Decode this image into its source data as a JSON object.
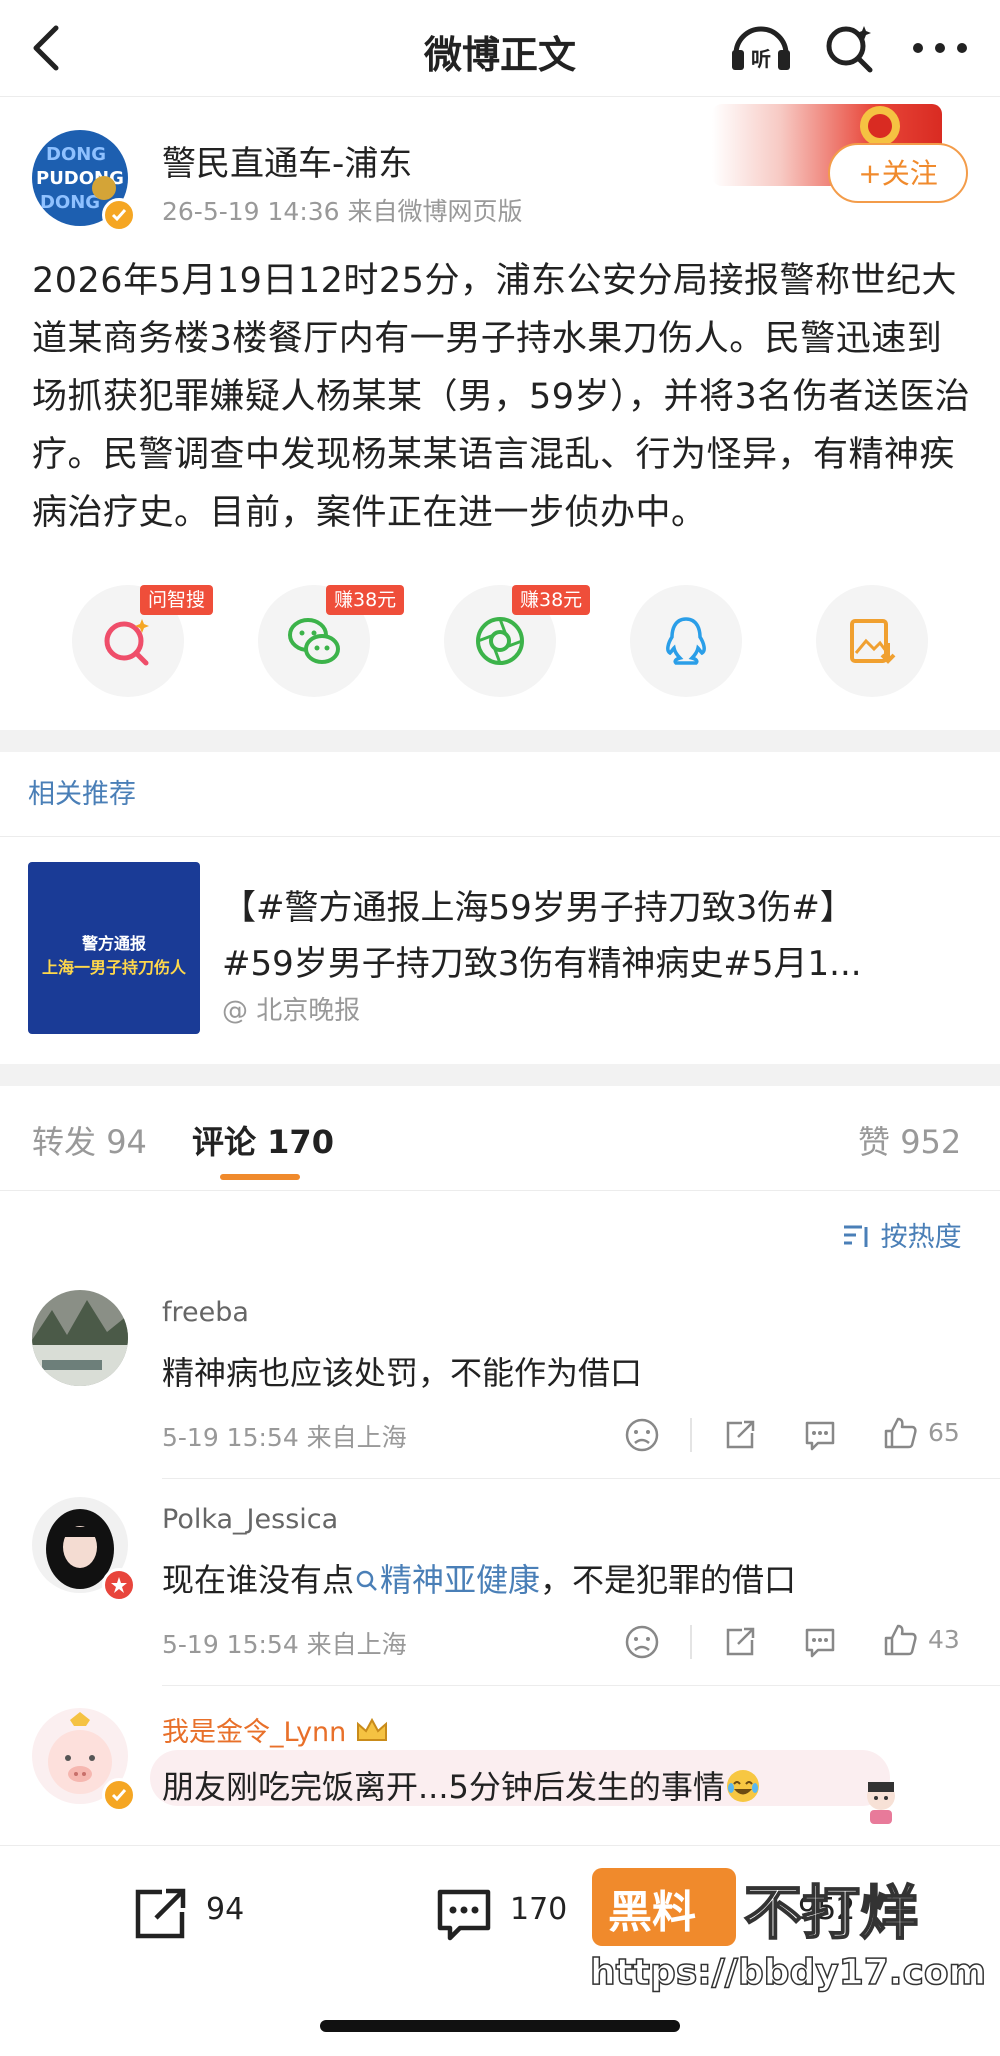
{
  "header": {
    "title": "微博正文",
    "listen_label": "听"
  },
  "post": {
    "username": "警民直通车-浦东",
    "meta": "26-5-19 14:36  来自微博网页版",
    "follow_label": "+关注",
    "avatar_text": [
      "DONG",
      "PUDONG",
      "DONG"
    ],
    "body": "2026年5月19日12时25分，浦东公安分局接报警称世纪大道某商务楼3楼餐厅内有一男子持水果刀伤人。民警迅速到场抓获犯罪嫌疑人杨某某（男，59岁），并将3名伤者送医治疗。民警调查中发现杨某某语言混乱、行为怪异，有精神疾病治疗史。目前，案件正在进一步侦办中。"
  },
  "share": {
    "badges": [
      "问智搜",
      "赚38元",
      "赚38元"
    ],
    "icons": [
      "ai-search-icon",
      "wechat-icon",
      "moments-icon",
      "qq-icon",
      "save-image-icon"
    ]
  },
  "related": {
    "label": "相关推荐",
    "thumb_line1": "警方通报",
    "thumb_line2": "上海一男子持刀伤人",
    "line1": "【#警方通报上海59岁男子持刀致3伤#】",
    "line2": "#59岁男子持刀致3伤有精神病史#5月1...",
    "source": "@ 北京晚报"
  },
  "tabs": {
    "repost_label": "转发",
    "repost_count": "94",
    "comment_label": "评论",
    "comment_count": "170",
    "like_label": "赞",
    "like_count": "952"
  },
  "sort_label": "按热度",
  "comments": [
    {
      "name": "freeba",
      "text": "精神病也应该处罚，不能作为借口",
      "meta": "5-19 15:54  来自上海",
      "likes": "65"
    },
    {
      "name": "Polka_Jessica",
      "text_before": "现在谁没有点",
      "topic": "精神亚健康",
      "text_after": "，不是犯罪的借口",
      "meta": "5-19 15:54  来自上海",
      "likes": "43"
    },
    {
      "name": "我是金令_Lynn",
      "text": "朋友刚吃完饭离开...5分钟后发生的事情"
    }
  ],
  "bottom": {
    "repost_count": "94",
    "comment_count": "170",
    "like_count_partial": "952"
  },
  "watermark": {
    "box_text": "黑料",
    "text": "不打烊",
    "url": "https://bbdy17.com"
  },
  "colors": {
    "accent_orange": "#f08a2c",
    "link_blue": "#4a7fb7",
    "badge_red": "#ef4e3a"
  }
}
